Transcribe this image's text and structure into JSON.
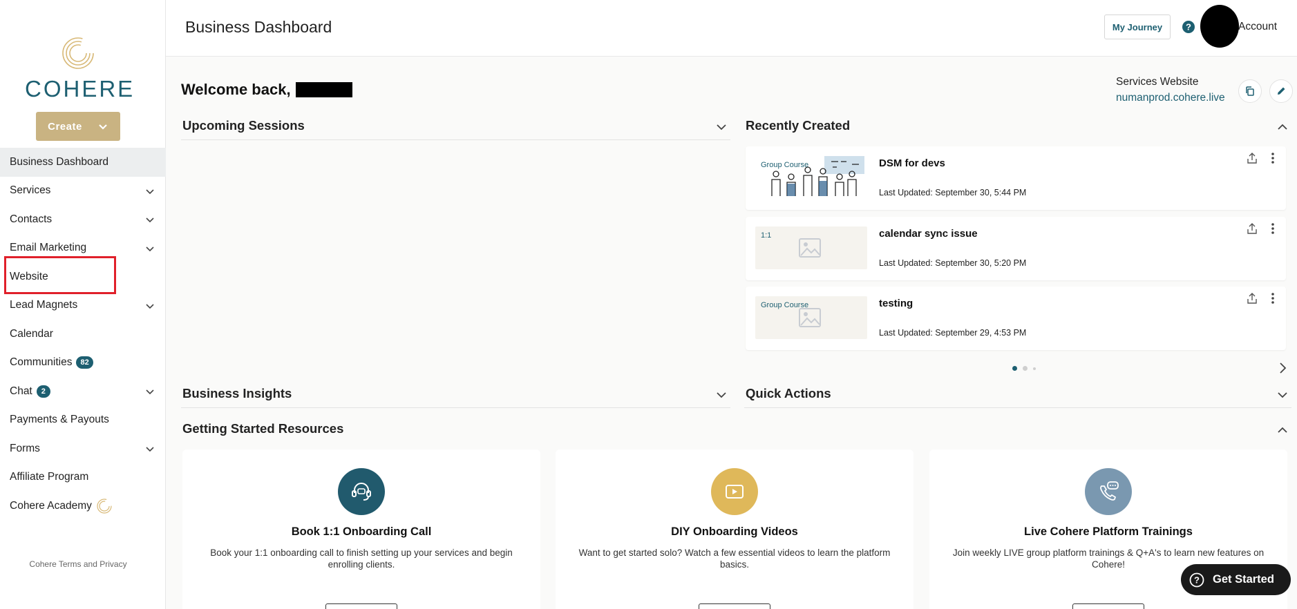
{
  "sidebar": {
    "logo_text": "COHERE",
    "create_label": "Create",
    "items": [
      {
        "label": "Business Dashboard",
        "chevron": false
      },
      {
        "label": "Services",
        "chevron": true
      },
      {
        "label": "Contacts",
        "chevron": true
      },
      {
        "label": "Email Marketing",
        "chevron": true
      },
      {
        "label": "Website",
        "chevron": false
      },
      {
        "label": "Lead Magnets",
        "chevron": true
      },
      {
        "label": "Calendar",
        "chevron": false
      },
      {
        "label": "Communities",
        "badge": "82"
      },
      {
        "label": "Chat",
        "badge": "2",
        "chevron": true
      },
      {
        "label": "Payments & Payouts",
        "chevron": false
      },
      {
        "label": "Forms",
        "chevron": true
      },
      {
        "label": "Affiliate Program",
        "chevron": false
      },
      {
        "label": "Cohere Academy",
        "chevron": false
      }
    ],
    "terms": "Cohere Terms and Privacy"
  },
  "header": {
    "title": "Business Dashboard",
    "journey_label": "My Journey",
    "account_label": "Account"
  },
  "welcome": {
    "text": "Welcome back,",
    "services_website_label": "Services Website",
    "services_website_url": "numanprod.cohere.live"
  },
  "sections": {
    "upcoming": "Upcoming Sessions",
    "recent": "Recently Created",
    "insights": "Business Insights",
    "quick": "Quick Actions",
    "resources": "Getting Started Resources"
  },
  "recent": [
    {
      "tag": "Group Course",
      "title": "DSM for devs",
      "updated": "Last Updated: September 30, 5:44 PM"
    },
    {
      "tag": "1:1",
      "title": "calendar sync issue",
      "updated": "Last Updated: September 30, 5:20 PM"
    },
    {
      "tag": "Group Course",
      "title": "testing",
      "updated": "Last Updated: September 29, 4:53 PM"
    }
  ],
  "resources": [
    {
      "title": "Book 1:1 Onboarding Call",
      "desc": "Book your 1:1 onboarding call to finish setting up your services and begin enrolling clients.",
      "color": "#215a6d"
    },
    {
      "title": "DIY Onboarding Videos",
      "desc": "Want to get started solo? Watch a few essential videos to learn the platform basics.",
      "color": "#dfb85a"
    },
    {
      "title": "Live Cohere Platform Trainings",
      "desc": "Join weekly LIVE group platform trainings & Q+A's to learn new features on Cohere!",
      "color": "#7a98b0"
    }
  ],
  "get_started_label": "Get Started",
  "colors": {
    "accent": "#1d5f71",
    "gold": "#c9b382",
    "highlight": "#e0202a"
  }
}
